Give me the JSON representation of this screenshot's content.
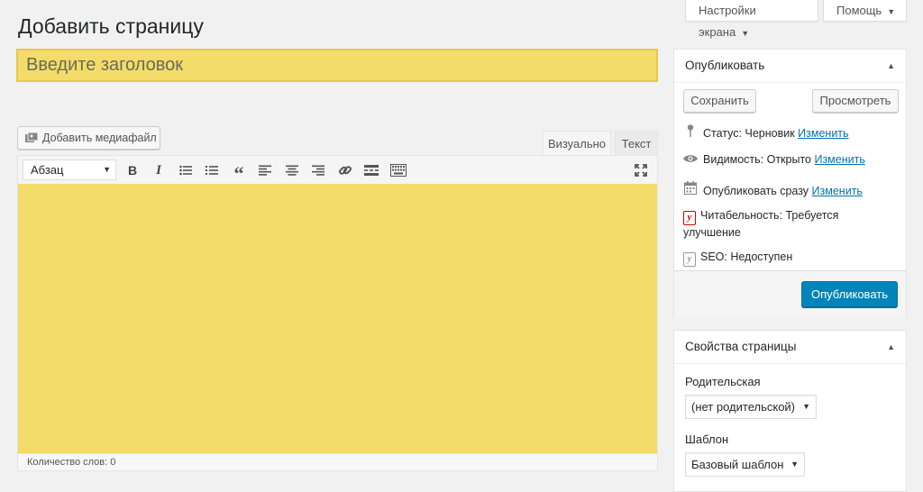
{
  "top": {
    "screen_options": "Настройки экрана",
    "help": "Помощь"
  },
  "page": {
    "title": "Добавить страницу"
  },
  "title_input": {
    "placeholder": "Введите заголовок"
  },
  "editor": {
    "add_media": "Добавить медиафайл",
    "tabs": {
      "visual": "Визуально",
      "text": "Текст"
    },
    "format_select": "Абзац",
    "word_count": "Количество слов: 0"
  },
  "publish": {
    "heading": "Опубликовать",
    "save": "Сохранить",
    "preview": "Просмотреть",
    "status_label": "Статус:",
    "status_value": "Черновик",
    "visibility_label": "Видимость:",
    "visibility_value": "Открыто",
    "schedule_label": "Опубликовать сразу",
    "edit_link": "Изменить",
    "readability": "Читабельность: Требуется улучшение",
    "seo": "SEO: Недоступен",
    "publish_button": "Опубликовать"
  },
  "page_attributes": {
    "heading": "Свойства страницы",
    "parent_label": "Родительская",
    "parent_value": "(нет родительской)",
    "template_label": "Шаблон",
    "template_value": "Базовый шаблон"
  },
  "colors": {
    "highlight": "#f4dc6a",
    "primary_button": "#0085ba",
    "link": "#0073aa"
  }
}
